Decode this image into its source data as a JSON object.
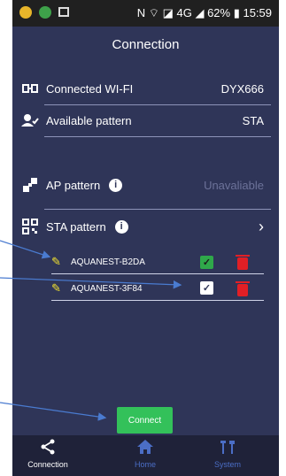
{
  "status_bar": {
    "text": "N ⌔ ◪ 4G ◢ 62% ▮ 15:59"
  },
  "header": {
    "title": "Connection"
  },
  "rows": {
    "connected_wifi": {
      "label": "Connected WI-FI",
      "value": "DYX666"
    },
    "available_pattern": {
      "label": "Available pattern",
      "value": "STA"
    },
    "ap_pattern": {
      "label": "AP pattern",
      "value": "Unavaliable"
    },
    "sta_pattern": {
      "label": "STA pattern"
    }
  },
  "networks": [
    {
      "name": "AQUANEST-B2DA",
      "selected": true
    },
    {
      "name": "AQUANEST-3F84",
      "selected": false
    }
  ],
  "connect_label": "Connect",
  "nav": {
    "tabs": [
      {
        "label": "Connection",
        "icon": "share-icon",
        "active": true
      },
      {
        "label": "Home",
        "icon": "home-icon",
        "active": false
      },
      {
        "label": "System",
        "icon": "tools-icon",
        "active": false
      }
    ]
  },
  "colors": {
    "background": "#2f3558",
    "navbar": "#1f2239",
    "accent_green": "#33c15a",
    "delete_red": "#e21f25",
    "pencil_yellow": "#f0e030",
    "annotation_arrow": "#4a7bd0"
  }
}
